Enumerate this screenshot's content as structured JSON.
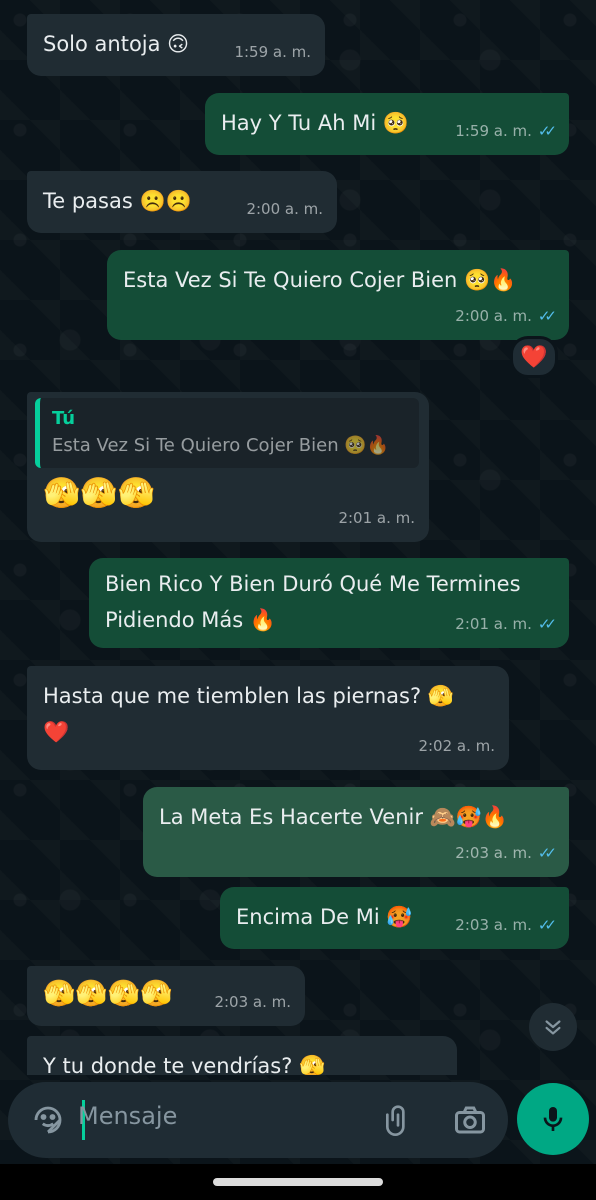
{
  "colors": {
    "incoming": "#202c33",
    "outgoing": "#144d37",
    "accent": "#00a884",
    "read_ticks": "#53bdeb"
  },
  "messages": [
    {
      "dir": "in",
      "text": "Solo antoja 🙃",
      "time": "1:59 a. m."
    },
    {
      "dir": "out",
      "text": "Hay Y Tu Ah Mi 🥺",
      "time": "1:59 a. m.",
      "status": "read"
    },
    {
      "dir": "in",
      "text": "Te pasas ☹️☹️",
      "time": "2:00 a. m."
    },
    {
      "dir": "out",
      "text": "Esta Vez Si Te Quiero Cojer Bien 🥺🔥",
      "time": "2:00 a. m.",
      "status": "read",
      "reaction": "❤️"
    },
    {
      "dir": "in",
      "quote": {
        "author": "Tú",
        "text": "Esta Vez Si Te Quiero Cojer Bien 🥺🔥"
      },
      "text": "🫣🫣🫣",
      "time": "2:01 a. m."
    },
    {
      "dir": "out",
      "text": "Bien Rico Y Bien Duró Qué Me Termines Pidiendo Más 🔥",
      "time": "2:01 a. m.",
      "status": "read"
    },
    {
      "dir": "in",
      "text": "Hasta que me tiemblen las piernas? 🫣 ❤️",
      "time": "2:02 a. m."
    },
    {
      "dir": "out",
      "text": "La Meta Es Hacerte Venir 🙈🥵🔥",
      "time": "2:03 a. m.",
      "status": "read"
    },
    {
      "dir": "out",
      "text": "Encima De Mi 🥵",
      "time": "2:03 a. m.",
      "status": "read"
    },
    {
      "dir": "in",
      "text": "🫣🫣🫣🫣",
      "time": "2:03 a. m."
    },
    {
      "dir": "in",
      "text": "Y tu donde te vendrías? 🫣",
      "time": ""
    }
  ],
  "composer": {
    "placeholder": "Mensaje",
    "emoji_icon": "sticker-icon",
    "attach_icon": "paperclip-icon",
    "camera_icon": "camera-icon",
    "mic_icon": "mic-icon"
  },
  "scroll_down_icon": "double-chevron-down-icon",
  "read_ticks": "✓✓"
}
